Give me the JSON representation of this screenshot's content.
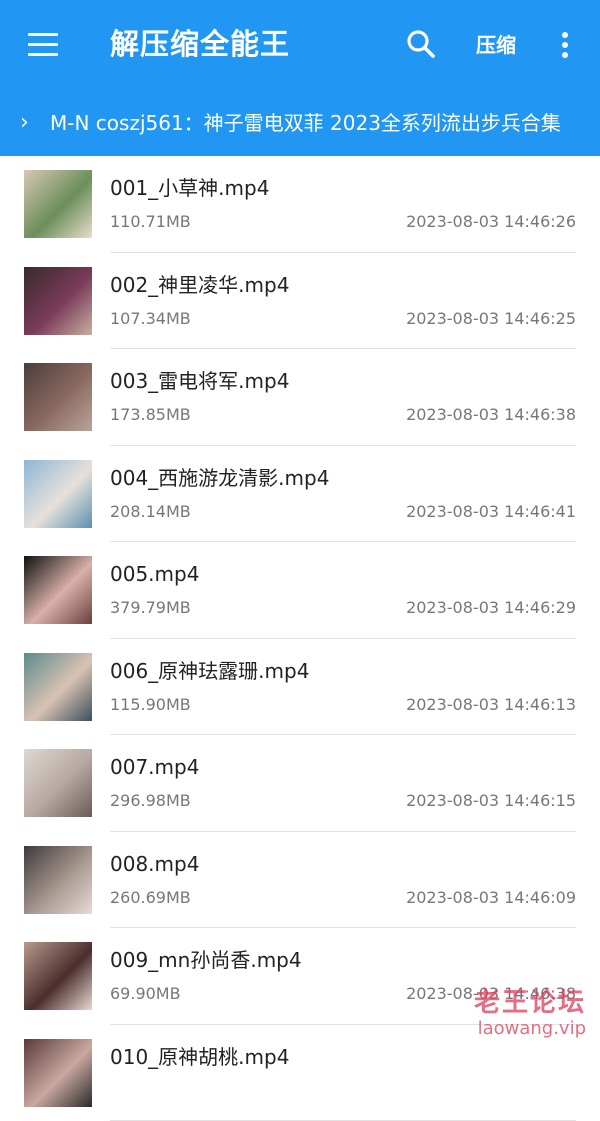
{
  "header": {
    "title": "解压缩全能王",
    "compress_label": "压缩",
    "menu_icon": "menu-icon",
    "search_icon": "search-icon",
    "more_icon": "more-vert-icon",
    "bg_color": "#2196f3"
  },
  "breadcrumb": {
    "chevron": "›",
    "path": "M-N coszj561：神子雷电双菲 2023全系列流出步兵合集"
  },
  "files": [
    {
      "name": "001_小草神.mp4",
      "size": "110.71MB",
      "date": "2023-08-03 14:46:26",
      "thumb_colors": [
        "#d8c7b6",
        "#6b8f5a",
        "#e8dccd"
      ]
    },
    {
      "name": "002_神里凌华.mp4",
      "size": "107.34MB",
      "date": "2023-08-03 14:46:25",
      "thumb_colors": [
        "#3a2a2a",
        "#7a3b5a",
        "#c8b0a0"
      ]
    },
    {
      "name": "003_雷电将军.mp4",
      "size": "173.85MB",
      "date": "2023-08-03 14:46:38",
      "thumb_colors": [
        "#4a3e3a",
        "#8a6a60",
        "#b9a49a"
      ]
    },
    {
      "name": "004_西施游龙清影.mp4",
      "size": "208.14MB",
      "date": "2023-08-03 14:46:41",
      "thumb_colors": [
        "#8fb6d6",
        "#e6e0da",
        "#5b8fb3"
      ]
    },
    {
      "name": "005.mp4",
      "size": "379.79MB",
      "date": "2023-08-03 14:46:29",
      "thumb_colors": [
        "#111111",
        "#d8b0a8",
        "#6a4040"
      ]
    },
    {
      "name": "006_原神珐露珊.mp4",
      "size": "115.90MB",
      "date": "2023-08-03 14:46:13",
      "thumb_colors": [
        "#5d8a8a",
        "#d9c2b4",
        "#3b4f5a"
      ]
    },
    {
      "name": "007.mp4",
      "size": "296.98MB",
      "date": "2023-08-03 14:46:15",
      "thumb_colors": [
        "#e0d8d2",
        "#b5a7a0",
        "#6a5a55"
      ]
    },
    {
      "name": "008.mp4",
      "size": "260.69MB",
      "date": "2023-08-03 14:46:09",
      "thumb_colors": [
        "#3d3a3a",
        "#a89890",
        "#e6dcd6"
      ]
    },
    {
      "name": "009_mn孙尚香.mp4",
      "size": "69.90MB",
      "date": "2023-08-03 14:46:38",
      "thumb_colors": [
        "#b89a8a",
        "#4a2e2e",
        "#e9d9d0"
      ]
    },
    {
      "name": "010_原神胡桃.mp4",
      "size": "",
      "date": "",
      "thumb_colors": [
        "#5a3a3a",
        "#c9a8a0",
        "#2a2a2a"
      ]
    }
  ],
  "watermark": {
    "main": "老王论坛",
    "sub": "laowang.vip"
  }
}
